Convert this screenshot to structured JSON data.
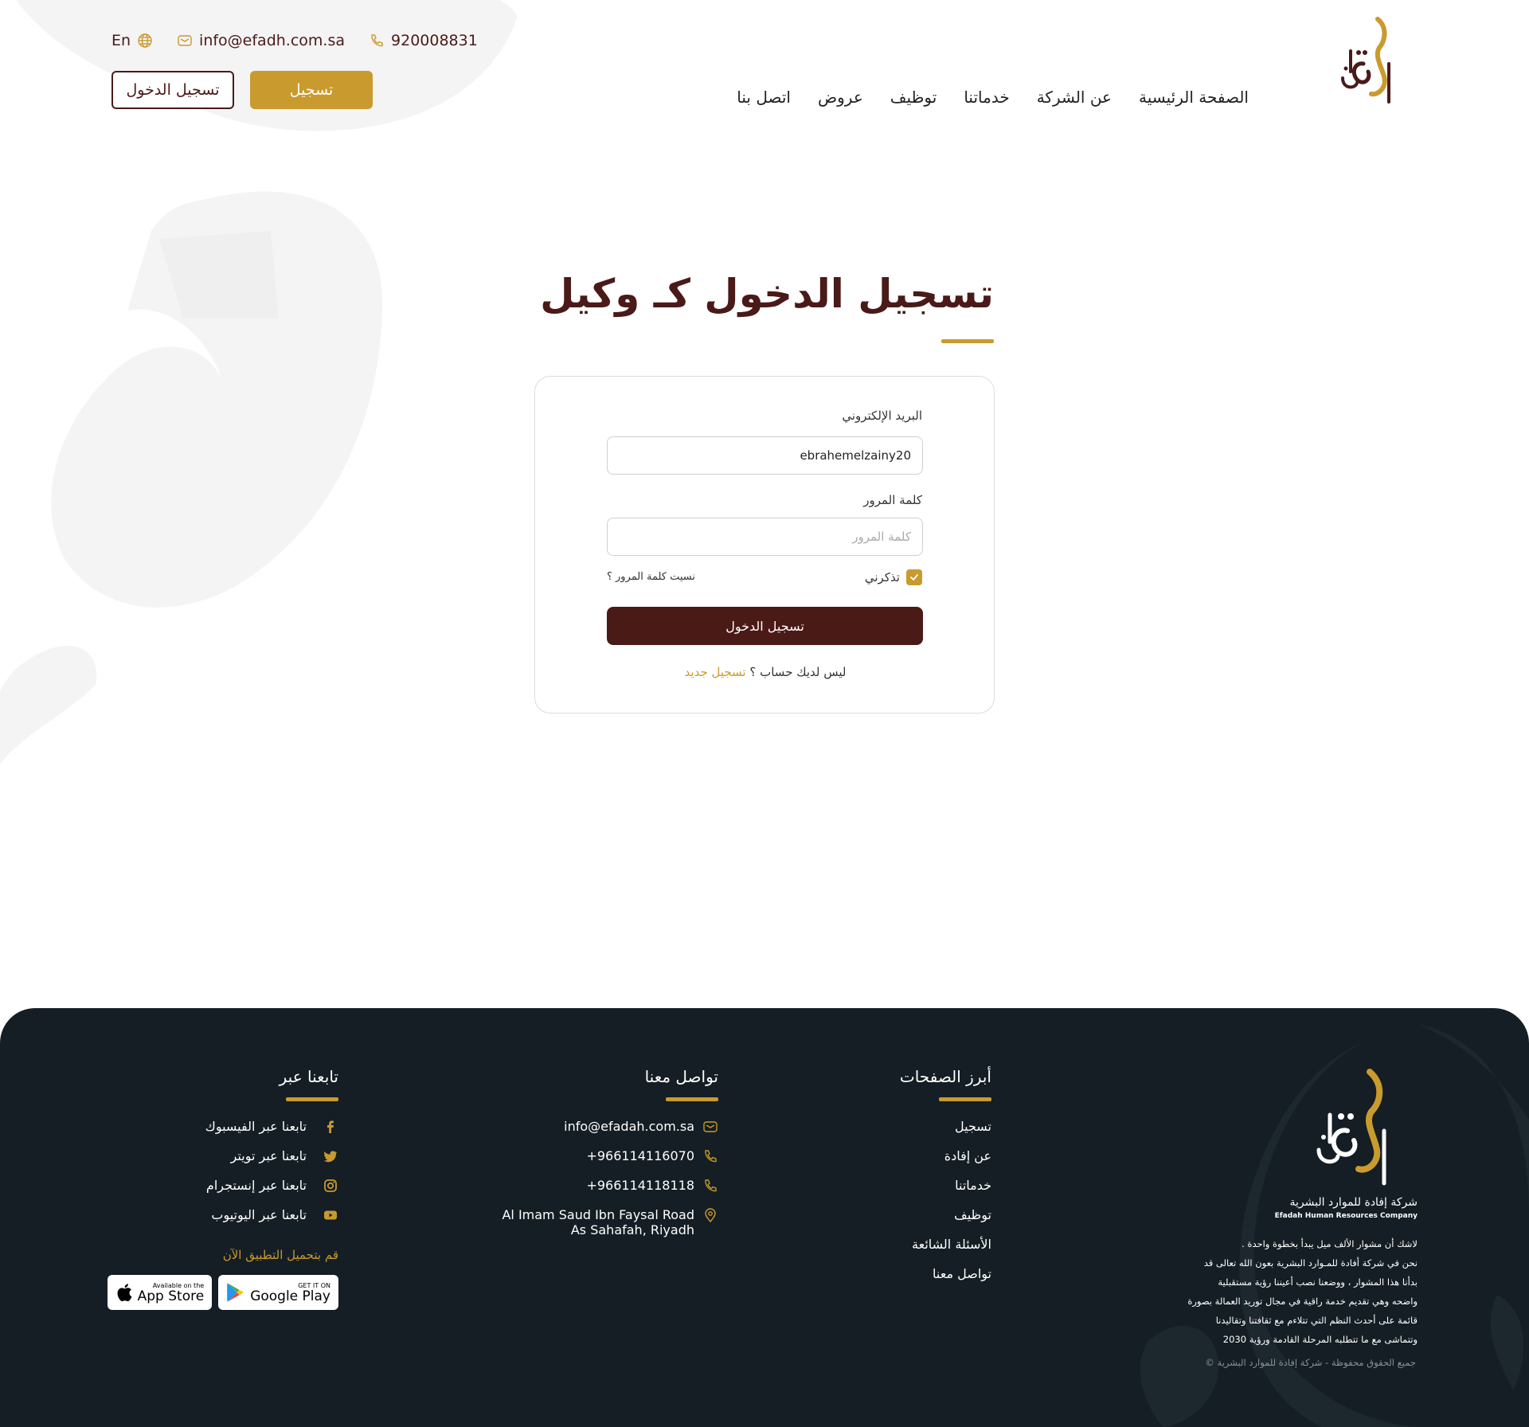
{
  "header": {
    "phone": "920008831",
    "email": "info@efadh.com.sa",
    "language": "En",
    "login_button": "تسجيل الدخول",
    "register_button": "تسجيل",
    "nav": [
      "الصفحة الرئيسية",
      "عن الشركة",
      "خدماتنا",
      "توظيف",
      "عروض",
      "اتصل بنا"
    ]
  },
  "main": {
    "title": "تسجيل الدخول كـ وكيل",
    "form": {
      "email_label": "البريد الإلكتروني",
      "email_value": "ebrahemelzainy20",
      "password_label": "كلمة المرور",
      "password_placeholder": "كلمة المرور",
      "remember_label": "تذكرني",
      "remember_checked": true,
      "forgot_link": "نسيت كلمة المرور ؟",
      "submit": "تسجيل الدخول",
      "no_account": "ليس لديك حساب ؟",
      "register_link": "تسجيل جديد"
    }
  },
  "footer": {
    "brand_ar": "شركة إفادة للموارد البشرية",
    "brand_en": "Efadah Human Resources Company",
    "about_lines": [
      "لاشك أن مشوار الألف ميل يبدأ بخطوة واحدة .",
      "نحن في شركة أفادة للمـوارد البشرية بعون الله تعالى قد",
      "بدأنا هذا المشوار ، ووضعنا نصب أعيننا رؤية مستقبلية",
      "واضحه وهي تقديم خدمة راقية في مجال توريد العمالة بصورة",
      "قائمة على أحدث النظم التي تتلاءم مع ثقافتنا وتقاليدنا",
      "وتتماشى مع ما تتطلبه المرحلة القادمة ورؤية 2030"
    ],
    "copyright": "جميع الحقوق محفوظة - شركة إفادة للموارد البشرية  ©",
    "pages": {
      "title": "أبرز الصفحات",
      "links": [
        "تسجيل",
        "عن إفادة",
        "خدماتنا",
        "توظيف",
        "الأسئلة الشائعة",
        "تواصل معنا"
      ]
    },
    "contact": {
      "title": "تواصل معنا",
      "email": "info@efadah.com.sa",
      "phone1": "+966114116070",
      "phone2": "+966114118118",
      "address_line1": "Al Imam Saud Ibn Faysal Road",
      "address_line2": "As Sahafah, Riyadh"
    },
    "social": {
      "title": "تابعنا عبر",
      "facebook": "تابعنا عبر الفيسبوك",
      "twitter": "تابعنا عبر تويتر",
      "instagram": "تابعنا عبر إنستجرام",
      "youtube": "تابعنا عبر اليوتيوب",
      "download": "قم بتحميل التطبيق الآن",
      "appstore_small": "Available on the",
      "appstore_big": "App Store",
      "googleplay_small": "GET IT ON",
      "googleplay_big": "Google Play"
    }
  },
  "colors": {
    "brand_maroon": "#4a1a18",
    "brand_gold": "#c99a2e",
    "footer_bg": "#141e24"
  }
}
